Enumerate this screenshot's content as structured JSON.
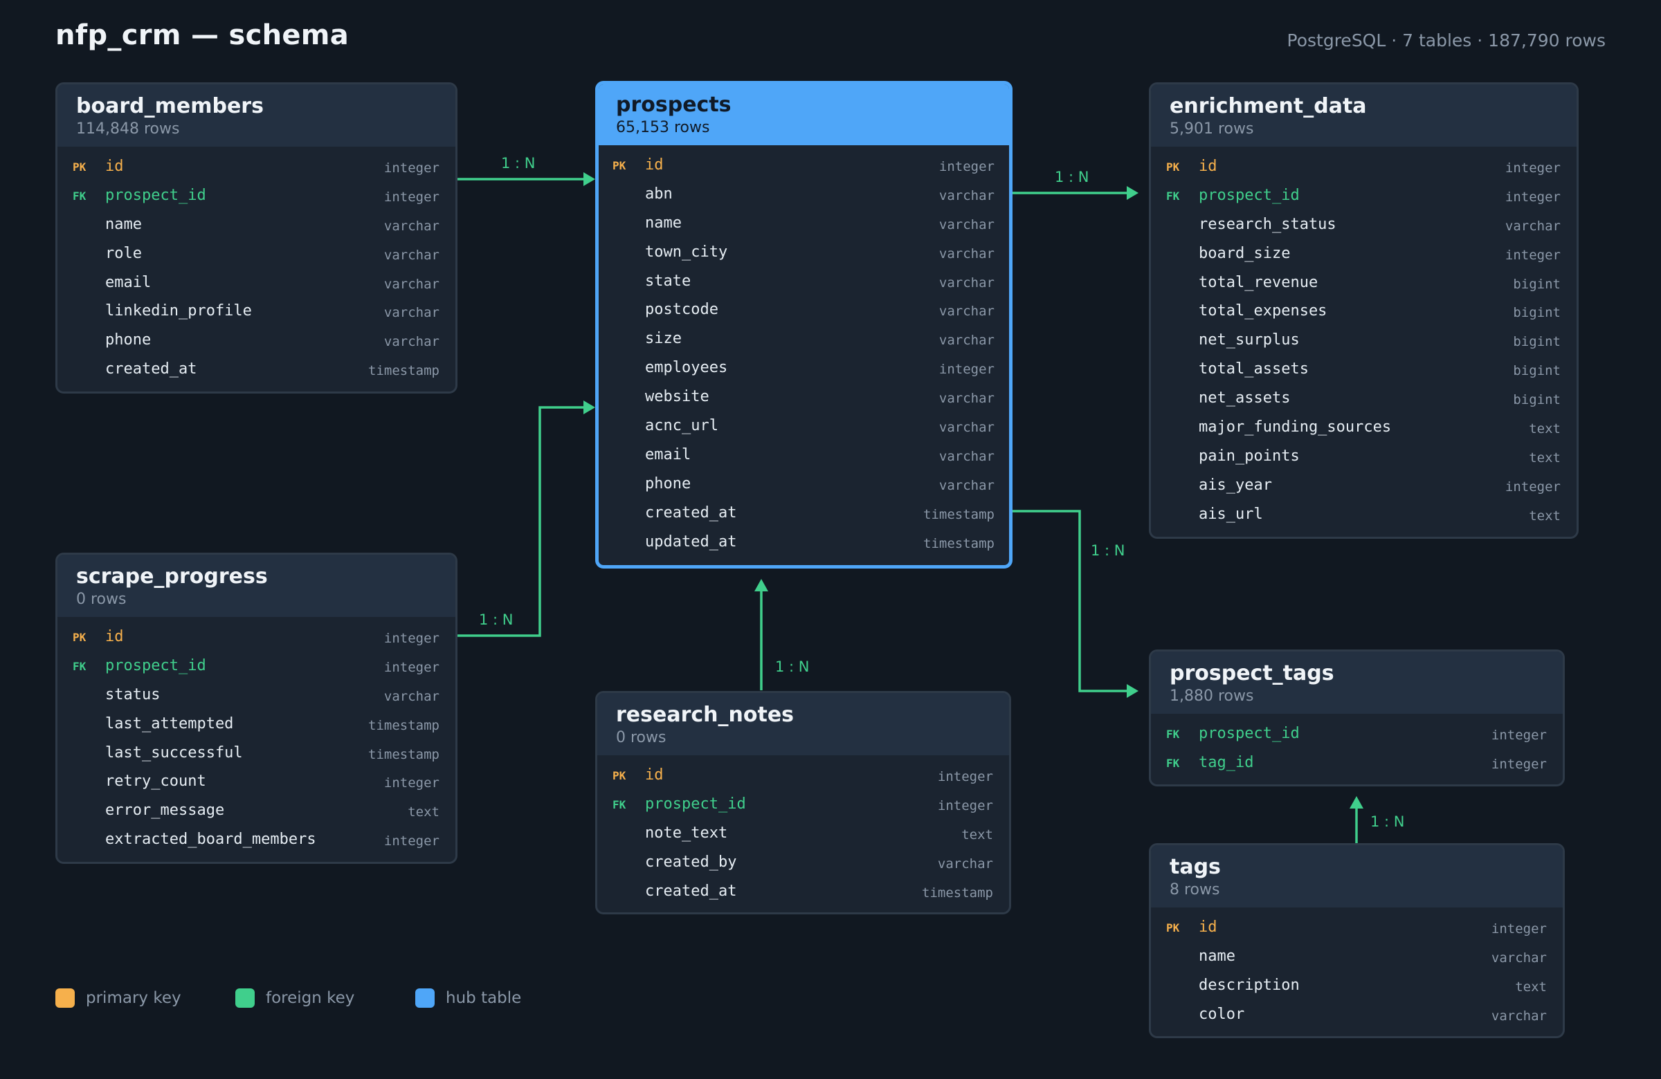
{
  "header": {
    "title": "nfp_crm — schema",
    "summary": "PostgreSQL · 7 tables · 187,790 rows"
  },
  "colors": {
    "background": "#111821",
    "primary_key": "#f6b04c",
    "foreign_key": "#40cf8c",
    "hub": "#4fa6f8",
    "relationship_line": "#40cf8c"
  },
  "tables": {
    "board_members": {
      "name": "board_members",
      "rows": "114,848 rows",
      "columns": [
        {
          "key": "PK",
          "name": "id",
          "type": "integer"
        },
        {
          "key": "FK",
          "name": "prospect_id",
          "type": "integer"
        },
        {
          "key": "",
          "name": "name",
          "type": "varchar"
        },
        {
          "key": "",
          "name": "role",
          "type": "varchar"
        },
        {
          "key": "",
          "name": "email",
          "type": "varchar"
        },
        {
          "key": "",
          "name": "linkedin_profile",
          "type": "varchar"
        },
        {
          "key": "",
          "name": "phone",
          "type": "varchar"
        },
        {
          "key": "",
          "name": "created_at",
          "type": "timestamp"
        }
      ]
    },
    "prospects": {
      "name": "prospects",
      "rows": "65,153 rows",
      "columns": [
        {
          "key": "PK",
          "name": "id",
          "type": "integer"
        },
        {
          "key": "",
          "name": "abn",
          "type": "varchar"
        },
        {
          "key": "",
          "name": "name",
          "type": "varchar"
        },
        {
          "key": "",
          "name": "town_city",
          "type": "varchar"
        },
        {
          "key": "",
          "name": "state",
          "type": "varchar"
        },
        {
          "key": "",
          "name": "postcode",
          "type": "varchar"
        },
        {
          "key": "",
          "name": "size",
          "type": "varchar"
        },
        {
          "key": "",
          "name": "employees",
          "type": "integer"
        },
        {
          "key": "",
          "name": "website",
          "type": "varchar"
        },
        {
          "key": "",
          "name": "acnc_url",
          "type": "varchar"
        },
        {
          "key": "",
          "name": "email",
          "type": "varchar"
        },
        {
          "key": "",
          "name": "phone",
          "type": "varchar"
        },
        {
          "key": "",
          "name": "created_at",
          "type": "timestamp"
        },
        {
          "key": "",
          "name": "updated_at",
          "type": "timestamp"
        }
      ]
    },
    "enrichment_data": {
      "name": "enrichment_data",
      "rows": "5,901 rows",
      "columns": [
        {
          "key": "PK",
          "name": "id",
          "type": "integer"
        },
        {
          "key": "FK",
          "name": "prospect_id",
          "type": "integer"
        },
        {
          "key": "",
          "name": "research_status",
          "type": "varchar"
        },
        {
          "key": "",
          "name": "board_size",
          "type": "integer"
        },
        {
          "key": "",
          "name": "total_revenue",
          "type": "bigint"
        },
        {
          "key": "",
          "name": "total_expenses",
          "type": "bigint"
        },
        {
          "key": "",
          "name": "net_surplus",
          "type": "bigint"
        },
        {
          "key": "",
          "name": "total_assets",
          "type": "bigint"
        },
        {
          "key": "",
          "name": "net_assets",
          "type": "bigint"
        },
        {
          "key": "",
          "name": "major_funding_sources",
          "type": "text"
        },
        {
          "key": "",
          "name": "pain_points",
          "type": "text"
        },
        {
          "key": "",
          "name": "ais_year",
          "type": "integer"
        },
        {
          "key": "",
          "name": "ais_url",
          "type": "text"
        }
      ]
    },
    "scrape_progress": {
      "name": "scrape_progress",
      "rows": "0 rows",
      "columns": [
        {
          "key": "PK",
          "name": "id",
          "type": "integer"
        },
        {
          "key": "FK",
          "name": "prospect_id",
          "type": "integer"
        },
        {
          "key": "",
          "name": "status",
          "type": "varchar"
        },
        {
          "key": "",
          "name": "last_attempted",
          "type": "timestamp"
        },
        {
          "key": "",
          "name": "last_successful",
          "type": "timestamp"
        },
        {
          "key": "",
          "name": "retry_count",
          "type": "integer"
        },
        {
          "key": "",
          "name": "error_message",
          "type": "text"
        },
        {
          "key": "",
          "name": "extracted_board_members",
          "type": "integer"
        }
      ]
    },
    "research_notes": {
      "name": "research_notes",
      "rows": "0 rows",
      "columns": [
        {
          "key": "PK",
          "name": "id",
          "type": "integer"
        },
        {
          "key": "FK",
          "name": "prospect_id",
          "type": "integer"
        },
        {
          "key": "",
          "name": "note_text",
          "type": "text"
        },
        {
          "key": "",
          "name": "created_by",
          "type": "varchar"
        },
        {
          "key": "",
          "name": "created_at",
          "type": "timestamp"
        }
      ]
    },
    "prospect_tags": {
      "name": "prospect_tags",
      "rows": "1,880 rows",
      "columns": [
        {
          "key": "FK",
          "name": "prospect_id",
          "type": "integer"
        },
        {
          "key": "FK",
          "name": "tag_id",
          "type": "integer"
        }
      ]
    },
    "tags": {
      "name": "tags",
      "rows": "8 rows",
      "columns": [
        {
          "key": "PK",
          "name": "id",
          "type": "integer"
        },
        {
          "key": "",
          "name": "name",
          "type": "varchar"
        },
        {
          "key": "",
          "name": "description",
          "type": "text"
        },
        {
          "key": "",
          "name": "color",
          "type": "varchar"
        }
      ]
    }
  },
  "relationships": [
    {
      "from": "board_members",
      "to": "prospects",
      "label": "1 : N"
    },
    {
      "from": "prospects",
      "to": "enrichment_data",
      "label": "1 : N"
    },
    {
      "from": "scrape_progress",
      "to": "prospects",
      "label": "1 : N"
    },
    {
      "from": "research_notes",
      "to": "prospects",
      "label": "1 : N"
    },
    {
      "from": "prospects",
      "to": "prospect_tags",
      "label": "1 : N"
    },
    {
      "from": "tags",
      "to": "prospect_tags",
      "label": "1 : N"
    }
  ],
  "legend": [
    {
      "label": "primary key",
      "color": "#f6b04c"
    },
    {
      "label": "foreign key",
      "color": "#40cf8c"
    },
    {
      "label": "hub table",
      "color": "#4fa6f8"
    }
  ]
}
